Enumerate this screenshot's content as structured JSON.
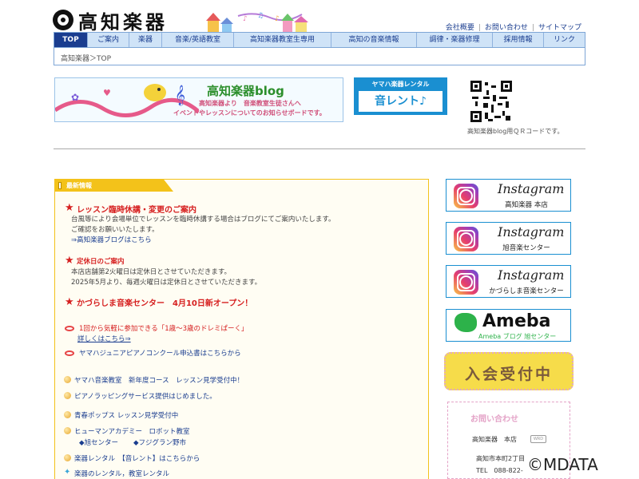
{
  "header": {
    "logo_text": "高知楽器",
    "toplinks": [
      "会社概要",
      "お問い合わせ",
      "サイトマップ"
    ]
  },
  "gnav": [
    {
      "label": "TOP",
      "active": true
    },
    {
      "label": "ご案内"
    },
    {
      "label": "楽器"
    },
    {
      "label": "音楽/英語教室"
    },
    {
      "label": "高知楽器教室生専用"
    },
    {
      "label": "高知の音楽情報"
    },
    {
      "label": "調律・楽器修理"
    },
    {
      "label": "採用情報"
    },
    {
      "label": "リンク"
    }
  ],
  "breadcrumb": "高知楽器＞TOP",
  "blog_banner": {
    "title": "高知楽器blog",
    "line1": "高知楽器より　音楽教室生徒さんへ",
    "line2": "イベントやレッスンについてのお知らせボードです。"
  },
  "rental_banner": {
    "top": "ヤマハ楽器レンタル",
    "main": "音レント♪"
  },
  "qr_caption": "高知楽器blog用ＱＲコードです。",
  "news": {
    "tab_label": "最新情報",
    "block1": {
      "headline": "レッスン臨時休講・変更のご案内",
      "line1": "台風等により会場単位でレッスンを臨時休講する場合はブログにてご案内いたします。",
      "line2": "ご確認をお願いいたします。",
      "link": "⇒高知楽器ブログはこちら"
    },
    "block2": {
      "headline": "定休日のご案内",
      "line1": "本店店舗第2火曜日は定休日とさせていただきます。",
      "line2": "2025年5月より、毎週火曜日は定休日とさせていただきます。"
    },
    "block3": {
      "headline": "かづらしま音楽センター　4月10日新オープン！"
    },
    "new_items": [
      {
        "text": "1回から気軽に参加できる「1歳～3歳のドレミぱーく」",
        "sub": "詳しくはこちら⇒"
      },
      {
        "text": "ヤマハジュニアピアノコンクール申込書はこちらから"
      }
    ],
    "dot_items": [
      "ヤマハ音楽教室　新年度コース　レッスン見学受付中！",
      "ピアノラッピングサービス提供はじめました。",
      "青春ポップス レッスン見学受付中",
      "ヒューマンアカデミー　ロボット教室",
      "楽器レンタル　【音レント】はこちらから"
    ],
    "robot_sub": [
      "◆旭センター",
      "◆フジグラン野市"
    ],
    "last_item": "楽器のレンタル，教室レンタル"
  },
  "sidebar": {
    "instagram": [
      {
        "word": "Instagram",
        "sub": "高知楽器 本店"
      },
      {
        "word": "Instagram",
        "sub": "旭音楽センター"
      },
      {
        "word": "Instagram",
        "sub": "かづらしま音楽センター"
      }
    ],
    "ameba": {
      "word": "Ameba",
      "sub": "Ameba ブログ 旭センター"
    },
    "join": "入会受付中",
    "contact": {
      "title": "お問い合わせ",
      "store": "高知楽器　本店",
      "badge": "WRD",
      "addr": "高知市本町2丁目",
      "tel": "TEL　088-822-"
    }
  },
  "copyright": "©MDATA"
}
